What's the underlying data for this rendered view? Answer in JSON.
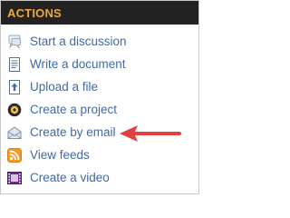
{
  "panel": {
    "title": "ACTIONS",
    "colors": {
      "header_bg": "#222222",
      "title": "#f0a83a",
      "link": "#3f6aa6",
      "arrow": "#e0403f",
      "border": "#c9c9c9"
    },
    "items": [
      {
        "label": "Start a discussion",
        "icon": "discussion-icon"
      },
      {
        "label": "Write a document",
        "icon": "document-icon"
      },
      {
        "label": "Upload a file",
        "icon": "upload-file-icon"
      },
      {
        "label": "Create a project",
        "icon": "project-icon"
      },
      {
        "label": "Create by email",
        "icon": "email-icon"
      },
      {
        "label": "View feeds",
        "icon": "rss-feed-icon"
      },
      {
        "label": "Create a video",
        "icon": "video-icon"
      }
    ]
  },
  "annotation": {
    "icon": "pointer-arrow-icon",
    "points_to": "Create by email"
  }
}
